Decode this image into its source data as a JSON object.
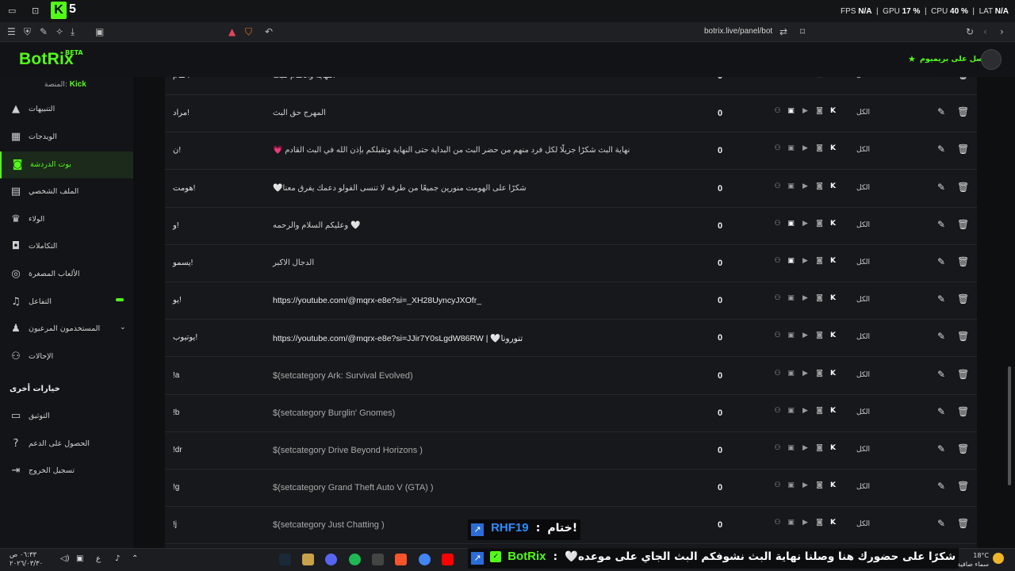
{
  "os_bar": {
    "kick_badge": "K",
    "kick_count": "5",
    "fps_label": "FPS",
    "fps_value": "N/A",
    "gpu_label": "GPU",
    "gpu_value": "17 %",
    "cpu_label": "CPU",
    "cpu_value": "40 %",
    "lat_label": "LAT",
    "lat_value": "N/A"
  },
  "browser": {
    "url": "botrix.live/panel/bot"
  },
  "header": {
    "brand": "BotRix",
    "beta": "BETA",
    "premium": "احصل على بريميوم"
  },
  "sidebar": {
    "platform_label": "المنصة:",
    "platform_value": "Kick",
    "items": [
      {
        "label": "التنبيهات",
        "icon": "warning-icon"
      },
      {
        "label": "الويدجات",
        "icon": "widgets-icon"
      },
      {
        "label": "بوت الدردشة",
        "icon": "robot-icon"
      },
      {
        "label": "الملف الشخصي",
        "icon": "profile-card-icon"
      },
      {
        "label": "الولاء",
        "icon": "trophy-icon"
      },
      {
        "label": "التكاملات",
        "icon": "integration-icon"
      },
      {
        "label": "الألعاب المصغرة",
        "icon": "gamepad-icon"
      },
      {
        "label": "التفاعل",
        "icon": "music-icon"
      },
      {
        "label": "المستخدمون المرعيون",
        "icon": "users-icon"
      },
      {
        "label": "الإحالات",
        "icon": "referrals-icon"
      }
    ],
    "other_options": "خيارات أخرى",
    "other_items": [
      {
        "label": "التوثيق",
        "icon": "book-icon"
      },
      {
        "label": "الحصول على الدعم",
        "icon": "help-icon"
      },
      {
        "label": "تسجيل الخروج",
        "icon": "logout-icon"
      }
    ]
  },
  "commands": [
    {
      "cmd": "ختام!",
      "response": "النهاية والختام للبث",
      "count": "0",
      "perm": "الكل",
      "twitch": false
    },
    {
      "cmd": "مراد!",
      "response": "المهرج حق البث",
      "count": "0",
      "perm": "الكل",
      "twitch": true
    },
    {
      "cmd": "ن!",
      "response": "💗 نهاية البث شكرًا جزيلًا لكل فرد منهم من حضر البث من البداية حتى النهاية وتقبلكم بإذن الله في البث القادم",
      "count": "0",
      "perm": "الكل",
      "twitch": false
    },
    {
      "cmd": "هومت!",
      "response": "🤍شكرًا على الهومت منورين جميعًا من طرفه لا تنسى الفولو دعمك يفرق معنا",
      "count": "0",
      "perm": "الكل",
      "twitch": false
    },
    {
      "cmd": "و!",
      "response": "وعليكم السلام والرحمه 🤍",
      "count": "0",
      "perm": "الكل",
      "twitch": true
    },
    {
      "cmd": "يسمو!",
      "response": "الدجال الاكبر",
      "count": "0",
      "perm": "الكل",
      "twitch": true
    },
    {
      "cmd": "يو!",
      "response": "https://youtube.com/@mqrx-e8e?si=_XH28UyncyJXOfr_",
      "count": "0",
      "perm": "الكل",
      "twitch": false
    },
    {
      "cmd": "يوتيوب!",
      "response": "https://youtube.com/@mqrx-e8e?si=JJir7Y0sLgdW86RW | 🤍تنورونا",
      "count": "0",
      "perm": "الكل",
      "twitch": false
    },
    {
      "cmd": "!a",
      "response": "$(setcategory Ark: Survival Evolved)",
      "count": "0",
      "perm": "الكل",
      "twitch": false
    },
    {
      "cmd": "!b",
      "response": "$(setcategory Burglin' Gnomes)",
      "count": "0",
      "perm": "الكل",
      "twitch": false
    },
    {
      "cmd": "!dr",
      "response": "$(setcategory Drive Beyond Horizons )",
      "count": "0",
      "perm": "الكل",
      "twitch": false
    },
    {
      "cmd": "!g",
      "response": "$(setcategory Grand Theft Auto V (GTA) )",
      "count": "0",
      "perm": "الكل",
      "twitch": false
    },
    {
      "cmd": "!j",
      "response": "$(setcategory Just Chatting )",
      "count": "0",
      "perm": "الكل",
      "twitch": false
    }
  ],
  "overlay": {
    "chat1_name": "RHF19",
    "chat1_sep": ":",
    "chat1_msg": "ختام!",
    "chat2_name": "BotRix",
    "chat2_sep": ":",
    "chat2_msg": "🤍شكرًا على حضورك هنا وصلنا نهاية البث نشوفكم البث الجاي على موعده"
  },
  "taskbar": {
    "time": "٠٦:٣٣ ص",
    "date": "٢٠٢٦/٠٣/٣٠",
    "lang": "ع",
    "temp": "18°C",
    "weather": "سماء صافية"
  },
  "colors": {
    "accent": "#53fc18",
    "background": "#0e0f11",
    "panel": "#17181b"
  }
}
